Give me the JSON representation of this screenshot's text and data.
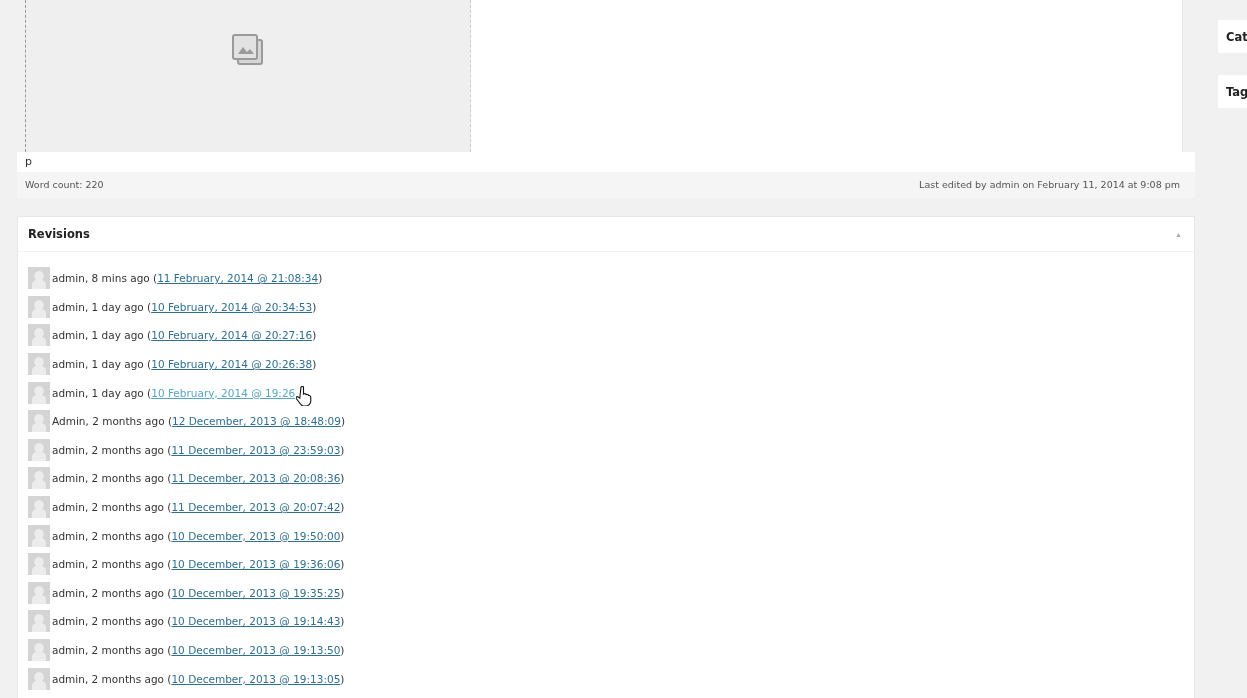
{
  "editor": {
    "path": "p",
    "word_count": "Word count: 220",
    "last_edited": "Last edited by admin on February 11, 2014 at 9:08 pm"
  },
  "revisions": {
    "title": "Revisions",
    "toggle": "▲",
    "items": [
      {
        "author": "admin, 8 mins ago",
        "open": "(",
        "link": "11 February, 2014 @ 21:08:34",
        "close": ")",
        "hovered": false
      },
      {
        "author": "admin, 1 day ago",
        "open": "(",
        "link": "10 February, 2014 @ 20:34:53",
        "close": ")",
        "hovered": false
      },
      {
        "author": "admin, 1 day ago",
        "open": "(",
        "link": "10 February, 2014 @ 20:27:16",
        "close": ")",
        "hovered": false
      },
      {
        "author": "admin, 1 day ago",
        "open": "(",
        "link": "10 February, 2014 @ 20:26:38",
        "close": ")",
        "hovered": false
      },
      {
        "author": "admin, 1 day ago",
        "open": "(",
        "link": "10 February, 2014 @ 19:26",
        "hovered": true
      },
      {
        "author": "Admin, 2 months ago",
        "open": "(",
        "link": "12 December, 2013 @ 18:48:09",
        "close": ")",
        "hovered": false
      },
      {
        "author": "admin, 2 months ago",
        "open": "(",
        "link": "11 December, 2013 @ 23:59:03",
        "close": ")",
        "hovered": false
      },
      {
        "author": "admin, 2 months ago",
        "open": "(",
        "link": "11 December, 2013 @ 20:08:36",
        "close": ")",
        "hovered": false
      },
      {
        "author": "admin, 2 months ago",
        "open": "(",
        "link": "11 December, 2013 @ 20:07:42",
        "close": ")",
        "hovered": false
      },
      {
        "author": "admin, 2 months ago",
        "open": "(",
        "link": "10 December, 2013 @ 19:50:00",
        "close": ")",
        "hovered": false
      },
      {
        "author": "admin, 2 months ago",
        "open": "(",
        "link": "10 December, 2013 @ 19:36:06",
        "close": ")",
        "hovered": false
      },
      {
        "author": "admin, 2 months ago",
        "open": "(",
        "link": "10 December, 2013 @ 19:35:25",
        "close": ")",
        "hovered": false
      },
      {
        "author": "admin, 2 months ago",
        "open": "(",
        "link": "10 December, 2013 @ 19:14:43",
        "close": ")",
        "hovered": false
      },
      {
        "author": "admin, 2 months ago",
        "open": "(",
        "link": "10 December, 2013 @ 19:13:50",
        "close": ")",
        "hovered": false
      },
      {
        "author": "admin, 2 months ago",
        "open": "(",
        "link": "10 December, 2013 @ 19:13:05",
        "close": ")",
        "hovered": false
      }
    ]
  },
  "sidebar": {
    "panels": [
      "Cat",
      "Tag"
    ]
  }
}
